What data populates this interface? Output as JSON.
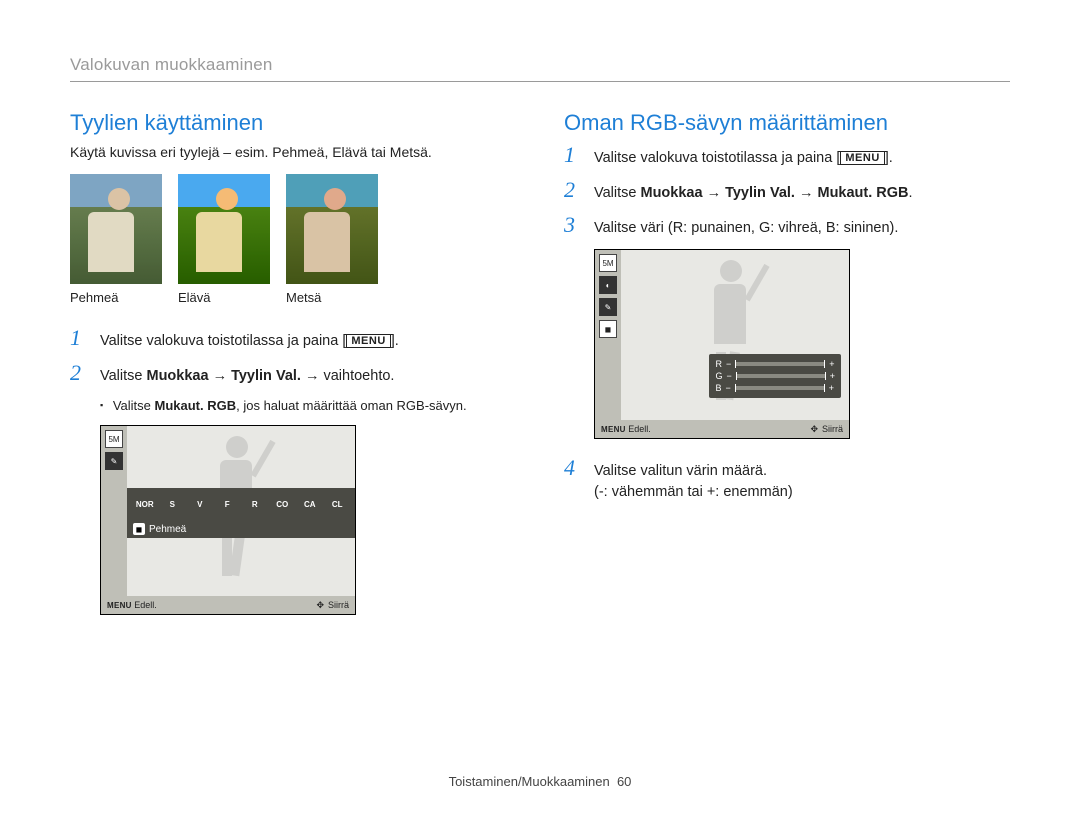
{
  "breadcrumb": "Valokuvan muokkaaminen",
  "left": {
    "title": "Tyylien käyttäminen",
    "intro": "Käytä kuvissa eri tyylejä – esim. Pehmeä, Elävä tai Metsä.",
    "thumb_labels": [
      "Pehmeä",
      "Elävä",
      "Metsä"
    ],
    "steps": [
      {
        "num": "1",
        "pre": "Valitse valokuva toistotilassa ja paina [",
        "menu": "MENU",
        "post": "]."
      },
      {
        "num": "2",
        "pre": "Valitse ",
        "bold": "Muokkaa → Tyylin Val.",
        "post2": " → vaihtoehto."
      }
    ],
    "bullet": {
      "pre": "Valitse ",
      "bold": "Mukaut. RGB",
      "post": ", jos haluat määrittää oman RGB-sävyn."
    },
    "lcd": {
      "size_badge": "5M",
      "style_chips": [
        "NOR",
        "S",
        "V",
        "F",
        "R",
        "CO",
        "CA",
        "CL"
      ],
      "selected_style_label": "Pehmeä",
      "footer_left_icon": "MENU",
      "footer_left": "Edell.",
      "footer_right": "Siirrä"
    }
  },
  "right": {
    "title": "Oman RGB-sävyn määrittäminen",
    "steps": [
      {
        "num": "1",
        "pre": "Valitse valokuva toistotilassa ja paina [",
        "menu": "MENU",
        "post": "]."
      },
      {
        "num": "2",
        "pre": "Valitse ",
        "bold": "Muokkaa → Tyylin Val. → Mukaut. RGB",
        "post2": "."
      },
      {
        "num": "3",
        "text": "Valitse väri (R: punainen, G: vihreä, B: sininen)."
      }
    ],
    "lcd": {
      "size_badge": "5M",
      "rgb_rows": [
        "R",
        "G",
        "B"
      ],
      "minus": "−",
      "plus": "+",
      "footer_left_icon": "MENU",
      "footer_left": "Edell.",
      "footer_right": "Siirrä"
    },
    "step4": {
      "num": "4",
      "line1": "Valitse valitun värin määrä.",
      "line2": "(-: vähemmän tai +: enemmän)"
    }
  },
  "footer": {
    "section": "Toistaminen/Muokkaaminen",
    "page": "60"
  }
}
